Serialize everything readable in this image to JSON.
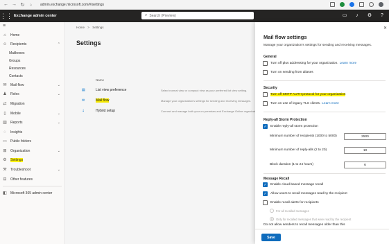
{
  "browser": {
    "url": "admin.exchange.microsoft.com/#/settings"
  },
  "header": {
    "app_title": "Exchange admin center",
    "search_placeholder": "Search (Preview)"
  },
  "nav": {
    "items": [
      {
        "label": "Home",
        "icon": "home-icon"
      },
      {
        "label": "Recipients",
        "icon": "person-icon",
        "expanded": true
      },
      {
        "label": "Mailboxes",
        "sub": true
      },
      {
        "label": "Groups",
        "sub": true
      },
      {
        "label": "Resources",
        "sub": true
      },
      {
        "label": "Contacts",
        "sub": true
      },
      {
        "label": "Mail flow",
        "icon": "mail-flow-icon"
      },
      {
        "label": "Roles",
        "icon": "roles-icon"
      },
      {
        "label": "Migration",
        "icon": "migration-icon"
      },
      {
        "label": "Mobile",
        "icon": "mobile-icon"
      },
      {
        "label": "Reports",
        "icon": "reports-icon"
      },
      {
        "label": "Insights",
        "icon": "insights-icon"
      },
      {
        "label": "Public folders",
        "icon": "folder-icon"
      },
      {
        "label": "Organization",
        "icon": "organization-icon"
      },
      {
        "label": "Settings",
        "icon": "gear-icon",
        "highlighted": true
      },
      {
        "label": "Troubleshoot",
        "icon": "troubleshoot-icon"
      },
      {
        "label": "Other features",
        "icon": "other-features-icon"
      }
    ],
    "admin_center_link": "Microsoft 365 admin center"
  },
  "main": {
    "breadcrumb_home": "Home",
    "breadcrumb_sep": ">",
    "breadcrumb_current": "Settings",
    "title": "Settings",
    "column_name": "Name",
    "rows": [
      {
        "name": "List view preference",
        "desc": "Select normal view or compact view as your preferred list view setting."
      },
      {
        "name": "Mail flow",
        "desc": "Manage your organization's settings for sending and receiving messages."
      },
      {
        "name": "Hybrid setup",
        "desc": "Connect and manage both your on-premises and Exchange Online organizations."
      }
    ]
  },
  "panel": {
    "title": "Mail flow settings",
    "subtitle": "Manage your organization's settings for sending and receiving messages.",
    "general": {
      "title": "General",
      "plus_addressing": "Turn off plus addressing for your organization.",
      "plus_link": "Learn more",
      "send_from_aliases": "Turn on sending from aliases"
    },
    "security": {
      "title": "Security",
      "smtp_auth": "Turn off SMTP AUTH protocol for your organization",
      "legacy_tls": "Turn on use of legacy TLS clients.",
      "tls_link": "Learn more"
    },
    "reply_all": {
      "title": "Reply-all Storm Protection",
      "enable": "Enable reply-all storm protection",
      "min_recipients_label": "Minimum number of recipients (1000 to 5000)",
      "min_recipients_value": "2500",
      "min_replies_label": "Minimum number of reply-alls (2 to 20)",
      "min_replies_value": "10",
      "block_duration_label": "Block duration (1 to 24 hours)",
      "block_duration_value": "6"
    },
    "recall": {
      "title": "Message Recall",
      "enable_cloud": "Enable cloud-based message recall",
      "allow_read": "Allow users to recall messages read by the recipient",
      "enable_alerts": "Enable recall alerts for recipients",
      "opt_all": "For all recalled messages",
      "opt_read": "Only for recalled messages that were read by the recipient",
      "older_than": "Do not allow senders to recall messages older than this"
    },
    "save_label": "Save",
    "close_label": "✕"
  }
}
